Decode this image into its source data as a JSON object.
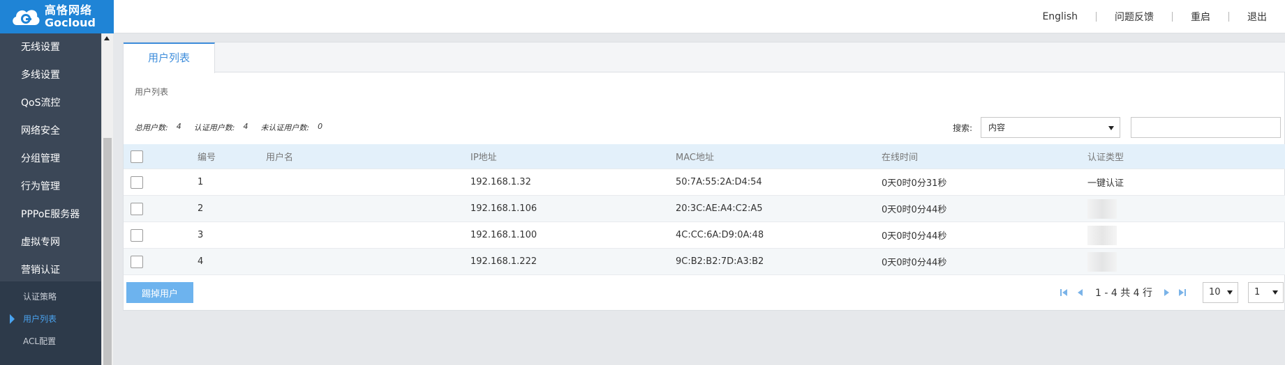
{
  "header": {
    "logo_cn": "高恪网络",
    "logo_en": "Gocloud",
    "nav": [
      "English",
      "问题反馈",
      "重启",
      "退出"
    ]
  },
  "sidebar": {
    "items": [
      "无线设置",
      "多线设置",
      "QoS流控",
      "网络安全",
      "分组管理",
      "行为管理",
      "PPPoE服务器",
      "虚拟专网",
      "营销认证"
    ],
    "sub_items": [
      "认证策略",
      "用户列表",
      "ACL配置"
    ],
    "active_sub": "用户列表"
  },
  "tab": {
    "label": "用户列表"
  },
  "section_title": "用户列表",
  "stats": {
    "total_label": "总用户数:",
    "total": "4",
    "auth_label": "认证用户数:",
    "auth": "4",
    "unauth_label": "未认证用户数:",
    "unauth": "0"
  },
  "search": {
    "label": "搜索:",
    "select_value": "内容",
    "input_value": ""
  },
  "table": {
    "columns": [
      "编号",
      "用户名",
      "IP地址",
      "MAC地址",
      "在线时间",
      "认证类型"
    ],
    "rows": [
      {
        "num": "1",
        "user": "",
        "ip": "192.168.1.32",
        "mac": "50:7A:55:2A:D4:54",
        "time": "0天0时0分31秒",
        "auth": "一键认证"
      },
      {
        "num": "2",
        "user": "",
        "ip": "192.168.1.106",
        "mac": "20:3C:AE:A4:C2:A5",
        "time": "0天0时0分44秒",
        "auth": ""
      },
      {
        "num": "3",
        "user": "",
        "ip": "192.168.1.100",
        "mac": "4C:CC:6A:D9:0A:48",
        "time": "0天0时0分44秒",
        "auth": ""
      },
      {
        "num": "4",
        "user": "",
        "ip": "192.168.1.222",
        "mac": "9C:B2:B2:7D:A3:B2",
        "time": "0天0时0分44秒",
        "auth": ""
      }
    ]
  },
  "footer": {
    "kick_button": "踢掉用户",
    "page_info": "1 - 4 共 4 行",
    "page_size": "10",
    "page_num": "1"
  },
  "colors": {
    "brand": "#1f84d6",
    "accent": "#3e8ddb",
    "button": "#6db3ee",
    "sidebar": "#3b4757"
  }
}
